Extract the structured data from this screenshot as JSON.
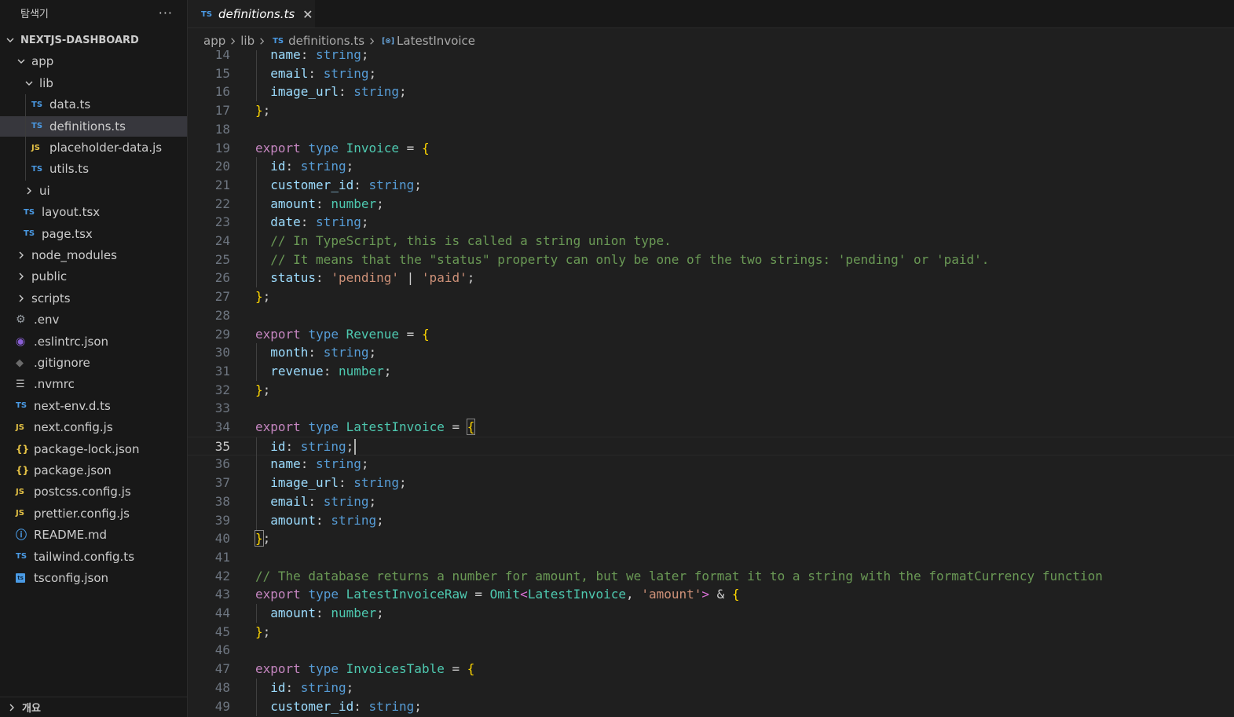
{
  "explorer": {
    "title": "탐색기",
    "more": "···",
    "project": "NEXTJS-DASHBOARD",
    "items": [
      {
        "label": "app",
        "kind": "folder",
        "open": true,
        "depth": 1
      },
      {
        "label": "lib",
        "kind": "folder",
        "open": true,
        "depth": 2
      },
      {
        "label": "data.ts",
        "kind": "ts",
        "depth": 3
      },
      {
        "label": "definitions.ts",
        "kind": "ts",
        "depth": 3,
        "selected": true
      },
      {
        "label": "placeholder-data.js",
        "kind": "js",
        "depth": 3
      },
      {
        "label": "utils.ts",
        "kind": "ts",
        "depth": 3
      },
      {
        "label": "ui",
        "kind": "folder",
        "open": false,
        "depth": 2
      },
      {
        "label": "layout.tsx",
        "kind": "ts",
        "depth": 2
      },
      {
        "label": "page.tsx",
        "kind": "ts",
        "depth": 2
      },
      {
        "label": "node_modules",
        "kind": "folder",
        "open": false,
        "depth": 1
      },
      {
        "label": "public",
        "kind": "folder",
        "open": false,
        "depth": 1
      },
      {
        "label": "scripts",
        "kind": "folder",
        "open": false,
        "depth": 1
      },
      {
        "label": ".env",
        "kind": "gear",
        "depth": 1
      },
      {
        "label": ".eslintrc.json",
        "kind": "eslint",
        "depth": 1
      },
      {
        "label": ".gitignore",
        "kind": "git",
        "depth": 1
      },
      {
        "label": ".nvmrc",
        "kind": "lines",
        "depth": 1
      },
      {
        "label": "next-env.d.ts",
        "kind": "ts",
        "depth": 1
      },
      {
        "label": "next.config.js",
        "kind": "js",
        "depth": 1
      },
      {
        "label": "package-lock.json",
        "kind": "json",
        "depth": 1
      },
      {
        "label": "package.json",
        "kind": "json",
        "depth": 1
      },
      {
        "label": "postcss.config.js",
        "kind": "js",
        "depth": 1
      },
      {
        "label": "prettier.config.js",
        "kind": "js",
        "depth": 1
      },
      {
        "label": "README.md",
        "kind": "info",
        "depth": 1
      },
      {
        "label": "tailwind.config.ts",
        "kind": "ts",
        "depth": 1
      },
      {
        "label": "tsconfig.json",
        "kind": "tsconfig",
        "depth": 1
      }
    ],
    "icon_text": {
      "ts": "TS",
      "js": "JS",
      "json": "{}",
      "gear": "⚙",
      "eslint": "◉",
      "git": "◆",
      "lines": "☰",
      "info": "ⓘ",
      "tsconfig": "ts"
    },
    "outline_label": "개요"
  },
  "tab": {
    "badge": "TS",
    "label": "definitions.ts",
    "close": "✕"
  },
  "breadcrumb": {
    "app": "app",
    "lib": "lib",
    "file_badge": "TS",
    "file": "definitions.ts",
    "symbol_icon": "[⊙]",
    "symbol": "LatestInvoice"
  },
  "editor": {
    "current_line": 35,
    "lines": [
      {
        "n": "14",
        "i": 1,
        "t": [
          [
            "name",
            "pr"
          ],
          [
            ": ",
            "pn"
          ],
          [
            "string",
            "kt"
          ],
          [
            ";",
            "pn"
          ]
        ]
      },
      {
        "n": "15",
        "i": 1,
        "t": [
          [
            "email",
            "pr"
          ],
          [
            ": ",
            "pn"
          ],
          [
            "string",
            "kt"
          ],
          [
            ";",
            "pn"
          ]
        ]
      },
      {
        "n": "16",
        "i": 1,
        "t": [
          [
            "image_url",
            "pr"
          ],
          [
            ": ",
            "pn"
          ],
          [
            "string",
            "kt"
          ],
          [
            ";",
            "pn"
          ]
        ]
      },
      {
        "n": "17",
        "i": 0,
        "t": [
          [
            "}",
            "br1"
          ],
          [
            ";",
            "pn"
          ]
        ]
      },
      {
        "n": "18",
        "i": 0,
        "t": []
      },
      {
        "n": "19",
        "i": 0,
        "t": [
          [
            "export",
            "kw"
          ],
          [
            " ",
            "pn"
          ],
          [
            "type",
            "kt"
          ],
          [
            " ",
            "pn"
          ],
          [
            "Invoice",
            "tn"
          ],
          [
            " = ",
            "pn"
          ],
          [
            "{",
            "br1"
          ]
        ]
      },
      {
        "n": "20",
        "i": 1,
        "t": [
          [
            "id",
            "pr"
          ],
          [
            ": ",
            "pn"
          ],
          [
            "string",
            "kt"
          ],
          [
            ";",
            "pn"
          ]
        ]
      },
      {
        "n": "21",
        "i": 1,
        "t": [
          [
            "customer_id",
            "pr"
          ],
          [
            ": ",
            "pn"
          ],
          [
            "string",
            "kt"
          ],
          [
            ";",
            "pn"
          ]
        ]
      },
      {
        "n": "22",
        "i": 1,
        "t": [
          [
            "amount",
            "pr"
          ],
          [
            ": ",
            "pn"
          ],
          [
            "number",
            "tn"
          ],
          [
            ";",
            "pn"
          ]
        ]
      },
      {
        "n": "23",
        "i": 1,
        "t": [
          [
            "date",
            "pr"
          ],
          [
            ": ",
            "pn"
          ],
          [
            "string",
            "kt"
          ],
          [
            ";",
            "pn"
          ]
        ]
      },
      {
        "n": "24",
        "i": 1,
        "t": [
          [
            "// In TypeScript, this is called a string union type.",
            "cm"
          ]
        ]
      },
      {
        "n": "25",
        "i": 1,
        "t": [
          [
            "// It means that the \"status\" property can only be one of the two strings: 'pending' or 'paid'.",
            "cm"
          ]
        ]
      },
      {
        "n": "26",
        "i": 1,
        "t": [
          [
            "status",
            "pr"
          ],
          [
            ": ",
            "pn"
          ],
          [
            "'pending'",
            "str"
          ],
          [
            " | ",
            "pn"
          ],
          [
            "'paid'",
            "str"
          ],
          [
            ";",
            "pn"
          ]
        ]
      },
      {
        "n": "27",
        "i": 0,
        "t": [
          [
            "}",
            "br1"
          ],
          [
            ";",
            "pn"
          ]
        ]
      },
      {
        "n": "28",
        "i": 0,
        "t": []
      },
      {
        "n": "29",
        "i": 0,
        "t": [
          [
            "export",
            "kw"
          ],
          [
            " ",
            "pn"
          ],
          [
            "type",
            "kt"
          ],
          [
            " ",
            "pn"
          ],
          [
            "Revenue",
            "tn"
          ],
          [
            " = ",
            "pn"
          ],
          [
            "{",
            "br1"
          ]
        ]
      },
      {
        "n": "30",
        "i": 1,
        "t": [
          [
            "month",
            "pr"
          ],
          [
            ": ",
            "pn"
          ],
          [
            "string",
            "kt"
          ],
          [
            ";",
            "pn"
          ]
        ]
      },
      {
        "n": "31",
        "i": 1,
        "t": [
          [
            "revenue",
            "pr"
          ],
          [
            ": ",
            "pn"
          ],
          [
            "number",
            "tn"
          ],
          [
            ";",
            "pn"
          ]
        ]
      },
      {
        "n": "32",
        "i": 0,
        "t": [
          [
            "}",
            "br1"
          ],
          [
            ";",
            "pn"
          ]
        ]
      },
      {
        "n": "33",
        "i": 0,
        "t": []
      },
      {
        "n": "34",
        "i": 0,
        "t": [
          [
            "export",
            "kw"
          ],
          [
            " ",
            "pn"
          ],
          [
            "type",
            "kt"
          ],
          [
            " ",
            "pn"
          ],
          [
            "LatestInvoice",
            "tn"
          ],
          [
            " = ",
            "pn"
          ],
          [
            "{",
            "br1 bracket-box"
          ]
        ]
      },
      {
        "n": "35",
        "i": 1,
        "t": [
          [
            "id",
            "pr"
          ],
          [
            ": ",
            "pn"
          ],
          [
            "string",
            "kt"
          ],
          [
            ";",
            "pn"
          ]
        ],
        "cursor": true
      },
      {
        "n": "36",
        "i": 1,
        "t": [
          [
            "name",
            "pr"
          ],
          [
            ": ",
            "pn"
          ],
          [
            "string",
            "kt"
          ],
          [
            ";",
            "pn"
          ]
        ]
      },
      {
        "n": "37",
        "i": 1,
        "t": [
          [
            "image_url",
            "pr"
          ],
          [
            ": ",
            "pn"
          ],
          [
            "string",
            "kt"
          ],
          [
            ";",
            "pn"
          ]
        ]
      },
      {
        "n": "38",
        "i": 1,
        "t": [
          [
            "email",
            "pr"
          ],
          [
            ": ",
            "pn"
          ],
          [
            "string",
            "kt"
          ],
          [
            ";",
            "pn"
          ]
        ]
      },
      {
        "n": "39",
        "i": 1,
        "t": [
          [
            "amount",
            "pr"
          ],
          [
            ": ",
            "pn"
          ],
          [
            "string",
            "kt"
          ],
          [
            ";",
            "pn"
          ]
        ]
      },
      {
        "n": "40",
        "i": 0,
        "t": [
          [
            "}",
            "br1 bracket-box"
          ],
          [
            ";",
            "pn"
          ]
        ]
      },
      {
        "n": "41",
        "i": 0,
        "t": []
      },
      {
        "n": "42",
        "i": 0,
        "t": [
          [
            "// The database returns a number for amount, but we later format it to a string with the formatCurrency function",
            "cm"
          ]
        ]
      },
      {
        "n": "43",
        "i": 0,
        "t": [
          [
            "export",
            "kw"
          ],
          [
            " ",
            "pn"
          ],
          [
            "type",
            "kt"
          ],
          [
            " ",
            "pn"
          ],
          [
            "LatestInvoiceRaw",
            "tn"
          ],
          [
            " = ",
            "pn"
          ],
          [
            "Omit",
            "tn"
          ],
          [
            "<",
            "br2"
          ],
          [
            "LatestInvoice",
            "tn"
          ],
          [
            ", ",
            "pn"
          ],
          [
            "'amount'",
            "str"
          ],
          [
            ">",
            "br2"
          ],
          [
            " & ",
            "pn"
          ],
          [
            "{",
            "br1"
          ]
        ]
      },
      {
        "n": "44",
        "i": 1,
        "t": [
          [
            "amount",
            "pr"
          ],
          [
            ": ",
            "pn"
          ],
          [
            "number",
            "tn"
          ],
          [
            ";",
            "pn"
          ]
        ]
      },
      {
        "n": "45",
        "i": 0,
        "t": [
          [
            "}",
            "br1"
          ],
          [
            ";",
            "pn"
          ]
        ]
      },
      {
        "n": "46",
        "i": 0,
        "t": []
      },
      {
        "n": "47",
        "i": 0,
        "t": [
          [
            "export",
            "kw"
          ],
          [
            " ",
            "pn"
          ],
          [
            "type",
            "kt"
          ],
          [
            " ",
            "pn"
          ],
          [
            "InvoicesTable",
            "tn"
          ],
          [
            " = ",
            "pn"
          ],
          [
            "{",
            "br1"
          ]
        ]
      },
      {
        "n": "48",
        "i": 1,
        "t": [
          [
            "id",
            "pr"
          ],
          [
            ": ",
            "pn"
          ],
          [
            "string",
            "kt"
          ],
          [
            ";",
            "pn"
          ]
        ]
      },
      {
        "n": "49",
        "i": 1,
        "t": [
          [
            "customer_id",
            "pr"
          ],
          [
            ": ",
            "pn"
          ],
          [
            "string",
            "kt"
          ],
          [
            ";",
            "pn"
          ]
        ]
      }
    ]
  }
}
